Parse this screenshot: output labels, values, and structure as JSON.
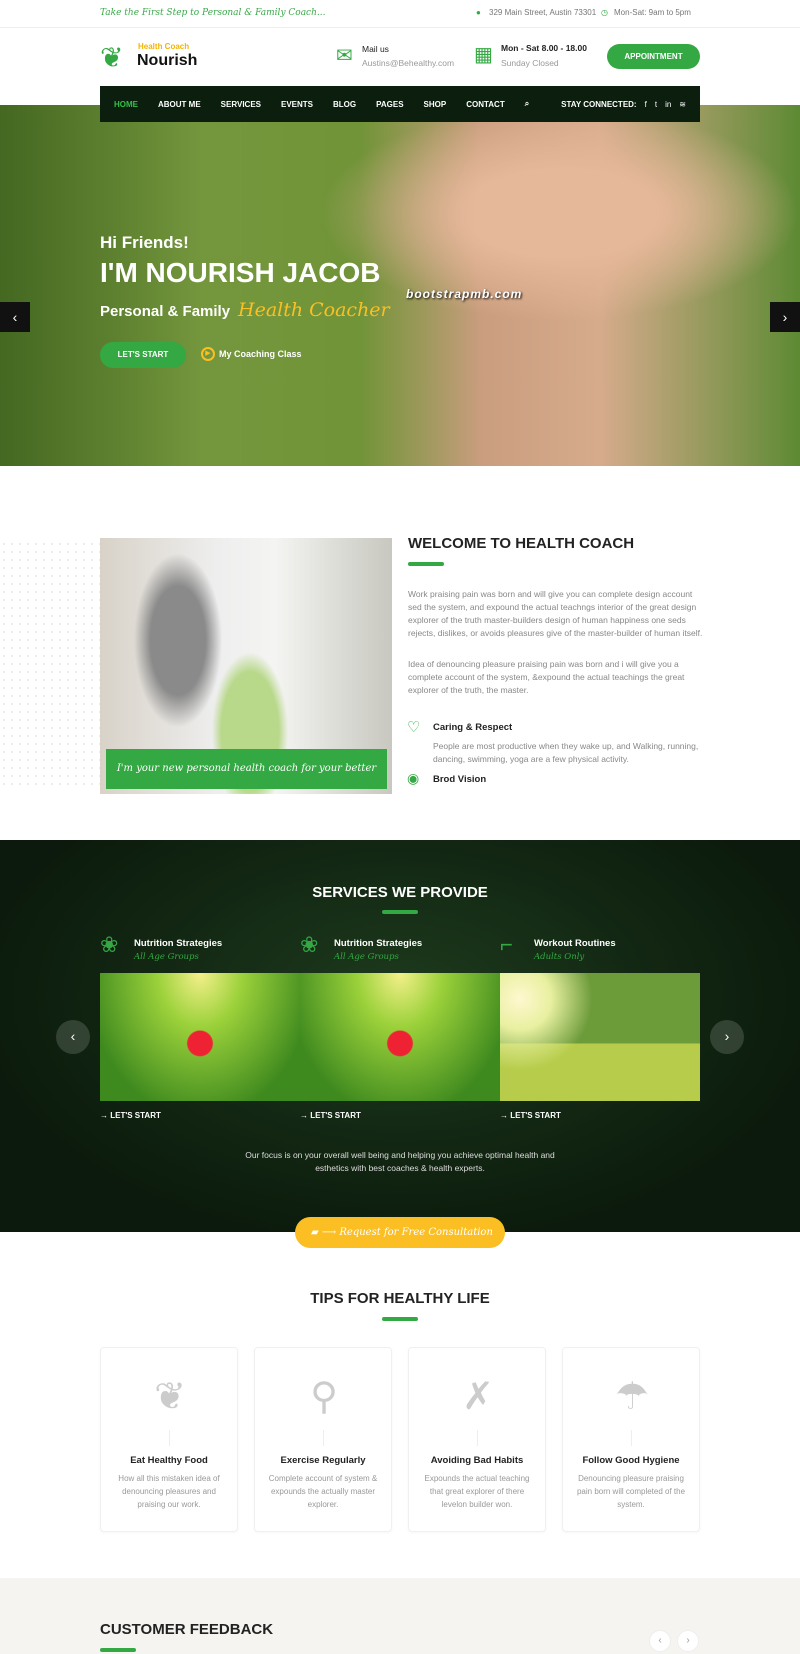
{
  "topbar": {
    "tagline": "Take the First Step to Personal & Family Coach...",
    "address": "329 Main Street, Austin 73301",
    "hours": "Mon-Sat: 9am to 5pm"
  },
  "header": {
    "logo_sub": "Health Coach",
    "logo_name": "Nourish",
    "mail_label": "Mail us",
    "mail_value": "Austins@Behealthy.com",
    "time_label": "Mon - Sat 8.00 - 18.00",
    "time_value": "Sunday Closed",
    "appointment": "APPOINTMENT"
  },
  "nav": {
    "items": [
      "HOME",
      "ABOUT ME",
      "SERVICES",
      "EVENTS",
      "BLOG",
      "PAGES",
      "SHOP",
      "CONTACT"
    ],
    "stay": "STAY CONNECTED:",
    "social": [
      "f",
      "t",
      "in",
      "rss"
    ]
  },
  "hero": {
    "greeting": "Hi Friends!",
    "name": "I'M NOURISH JACOB",
    "subtitle": "Personal & Family",
    "highlight": "Health Coacher",
    "watermark": "bootstrapmb.com",
    "start": "LET'S START",
    "class_link": "My Coaching Class"
  },
  "about": {
    "caption": "I'm your new personal health coach for your better life.",
    "title": "WELCOME TO HEALTH COACH",
    "p1": "Work praising pain was born and will give you can complete design account sed the system, and expound the actual teachngs interior of the great design explorer of the truth master-builders design of human happiness one seds rejects, dislikes, or avoids pleasures give of the master-builder of human itself.",
    "p2": "Idea of denouncing pleasure praising pain was born and i will give you a complete account of the system, &expound the actual teachings the great explorer of the truth, the master.",
    "f1_title": "Caring & Respect",
    "f1_text": "People are most productive when they wake up, and Walking, running, dancing, swimming, yoga are a few physical activity.",
    "f2_title": "Brod Vision"
  },
  "services": {
    "title": "SERVICES WE PROVIDE",
    "items": [
      {
        "title": "Nutrition Strategies",
        "sub": "All Age Groups",
        "link": "LET'S START"
      },
      {
        "title": "Nutrition Strategies",
        "sub": "All Age Groups",
        "link": "LET'S START"
      },
      {
        "title": "Workout Routines",
        "sub": "Adults Only",
        "link": "LET'S START"
      }
    ],
    "focus": "Our focus is on your overall well being and helping you achieve optimal health and esthetics with best coaches & health experts.",
    "consult": "Request for Free Consultation"
  },
  "tips": {
    "title": "TIPS FOR HEALTHY LIFE",
    "items": [
      {
        "title": "Eat Healthy Food",
        "text": "How all this mistaken idea of denouncing pleasures and praising our work."
      },
      {
        "title": "Exercise Regularly",
        "text": "Complete account of system & expounds the actually master explorer."
      },
      {
        "title": "Avoiding Bad Habits",
        "text": "Expounds the actual teaching that great explorer of there levelon builder won."
      },
      {
        "title": "Follow Good Hygiene",
        "text": "Denouncing pleasure praising pain born will completed of the system."
      }
    ]
  },
  "feedback": {
    "title": "CUSTOMER FEEDBACK"
  },
  "colors": {
    "accent": "#34a843",
    "yellow": "#fbbf24",
    "dark": "#0c1f0e"
  }
}
